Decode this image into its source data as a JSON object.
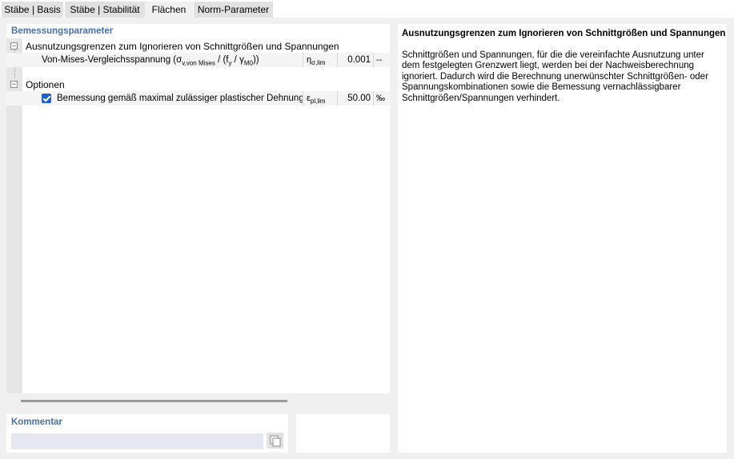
{
  "tabs": [
    {
      "label": "Stäbe | Basis"
    },
    {
      "label": "Stäbe | Stabilität"
    },
    {
      "label": "Flächen"
    },
    {
      "label": "Norm-Parameter"
    }
  ],
  "design_params": {
    "title": "Bemessungsparameter",
    "group1": {
      "label": "Ausnutzungsgrenzen zum Ignorieren von Schnittgrößen und Spannungen",
      "expander": "−",
      "param": {
        "label_main": "Von-Mises-Vergleichsspannung (σ",
        "label_sub1": "v,von Mises",
        "label_mid": " / (f",
        "label_sub2": "y",
        "label_mid2": " / γ",
        "label_sub3": "M0",
        "label_end": "))",
        "symbol": "η",
        "symbol_sub": "σ,lim",
        "value": "0.001",
        "unit": "--"
      }
    },
    "group2": {
      "label": "Optionen",
      "expander": "−",
      "param": {
        "label": "Bemessung gemäß maximal zulässiger plastischer Dehnung",
        "checked": true,
        "symbol": "ε",
        "symbol_sub": "pl,lim",
        "value": "50.00",
        "unit": "‰"
      }
    }
  },
  "description": {
    "title": "Ausnutzungsgrenzen zum Ignorieren von Schnittgrößen und Spannungen",
    "body": "Schnittgrößen und Spannungen, für die die vereinfachte Ausnutzung unter dem festgelegten Grenzwert liegt, werden bei der Nachweisberechnung ignoriert. Dadurch wird die Berechnung unerwünschter Schnittgrößen- oder Spannungskombinationen sowie die Bemessung vernachlässigbarer Schnittgrößen/Spannungen verhindert."
  },
  "comment": {
    "title": "Kommentar",
    "value": "",
    "button_icon": "copy-icon"
  }
}
